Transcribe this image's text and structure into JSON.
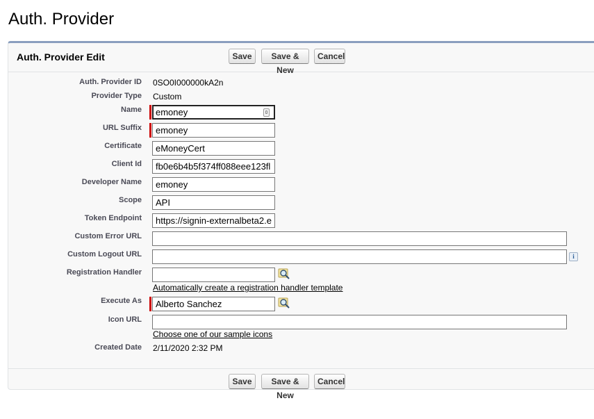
{
  "page": {
    "title": "Auth. Provider"
  },
  "edit": {
    "title": "Auth. Provider Edit",
    "buttons": {
      "save": "Save",
      "save_new": "Save & New",
      "cancel": "Cancel"
    }
  },
  "fields": {
    "auth_provider_id": {
      "label": "Auth. Provider ID",
      "value": "0SO0I000000kA2n"
    },
    "provider_type": {
      "label": "Provider Type",
      "value": "Custom"
    },
    "name": {
      "label": "Name",
      "value": "emoney"
    },
    "url_suffix": {
      "label": "URL Suffix",
      "value": "emoney"
    },
    "certificate": {
      "label": "Certificate",
      "value": "eMoneyCert"
    },
    "client_id": {
      "label": "Client Id",
      "value": "fb0e6b4b5f374ff088eee123fl"
    },
    "developer_name": {
      "label": "Developer Name",
      "value": "emoney"
    },
    "scope": {
      "label": "Scope",
      "value": "API"
    },
    "token_endpoint": {
      "label": "Token Endpoint",
      "value": "https://signin-externalbeta2.e"
    },
    "custom_error_url": {
      "label": "Custom Error URL",
      "value": ""
    },
    "custom_logout_url": {
      "label": "Custom Logout URL",
      "value": ""
    },
    "registration_handler": {
      "label": "Registration Handler",
      "value": "",
      "link": "Automatically create a registration handler template"
    },
    "execute_as": {
      "label": "Execute As",
      "value": "Alberto Sanchez"
    },
    "icon_url": {
      "label": "Icon URL",
      "value": "",
      "link": "Choose one of our sample icons"
    },
    "created_date": {
      "label": "Created Date",
      "value": "2/11/2020 2:32 PM"
    }
  },
  "icons": {
    "lookup": "lookup-magnifier-icon",
    "info": "info-icon"
  },
  "colors": {
    "required": "#cc0000",
    "panel_border": "#8a9ebe",
    "panel_bg": "#f8f8f8"
  }
}
